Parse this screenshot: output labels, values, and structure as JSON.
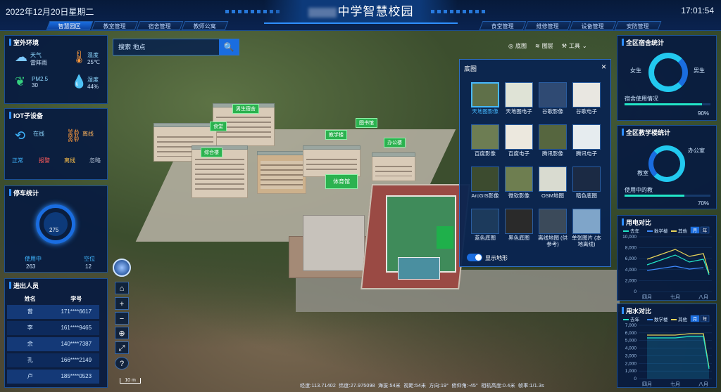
{
  "header": {
    "date": "2022年12月20日星期二",
    "title": "中学智慧校园",
    "time": "17:01:54",
    "tabs_left": [
      "智慧园区",
      "教室管理",
      "宿舍管理",
      "教师公寓"
    ],
    "tabs_right": [
      "食堂管理",
      "维修管理",
      "设备管理",
      "安防管理"
    ]
  },
  "outdoor": {
    "title": "室外环境",
    "weather_label": "天气",
    "weather_value": "雷阵雨",
    "temp_label": "温度",
    "temp_value": "25℃",
    "pm_label": "PM2.5",
    "pm_value": "30",
    "humidity_label": "湿度",
    "humidity_value": "44%"
  },
  "iot": {
    "title": "IOT子设备",
    "online": "在线",
    "offline": "离线",
    "normal": "正常",
    "alarm": "报警",
    "offline2": "离线",
    "ignore": "忽略"
  },
  "parking": {
    "title": "停车统计",
    "total": "275",
    "in_use_label": "使用中",
    "in_use": "263",
    "free_label": "空位",
    "free": "12"
  },
  "people": {
    "title": "进出人员",
    "col_name": "姓名",
    "col_id": "学号",
    "rows": [
      {
        "name": "曾",
        "id": "171****6617"
      },
      {
        "name": "李",
        "id": "161****9465"
      },
      {
        "name": "余",
        "id": "140****7387"
      },
      {
        "name": "孔",
        "id": "166****2149"
      },
      {
        "name": "卢",
        "id": "185****0523"
      }
    ]
  },
  "search": {
    "placeholder": "搜索 地点",
    "btn": "🔍"
  },
  "toolbar": {
    "basemap": "底图",
    "layers": "图层",
    "tools": "工具"
  },
  "basemap": {
    "title": "底图",
    "close": "×",
    "toggle_label": "显示地形",
    "items": [
      {
        "label": "天地图影像",
        "color": "#5f7049"
      },
      {
        "label": "天地图电子",
        "color": "#dfe3d6"
      },
      {
        "label": "谷歌影像",
        "color": "#2f4a73"
      },
      {
        "label": "谷歌电子",
        "color": "#e9e7e1"
      },
      {
        "label": "百度影像",
        "color": "#6d7d53"
      },
      {
        "label": "百度电子",
        "color": "#ece8de"
      },
      {
        "label": "腾讯影像",
        "color": "#56663f"
      },
      {
        "label": "腾讯电子",
        "color": "#e6ecef"
      },
      {
        "label": "ArcGIS影像",
        "color": "#3c4b2f"
      },
      {
        "label": "微软影像",
        "color": "#6e7e50"
      },
      {
        "label": "OSM地图",
        "color": "#d9dbd0"
      },
      {
        "label": "暗色底图",
        "color": "#1b2a44"
      },
      {
        "label": "蓝色底图",
        "color": "#1c3a5c"
      },
      {
        "label": "黑色底图",
        "color": "#2a2a2a"
      },
      {
        "label": "离线地图 (供参考)",
        "color": "#3b4a5a"
      },
      {
        "label": "单张图片 (本地离线)",
        "color": "#7fa5c9"
      }
    ]
  },
  "dorm": {
    "title": "全区宿舍统计",
    "female": "女生",
    "male": "男生",
    "usage_label": "宿舍使用情况",
    "usage": "90%",
    "usage_value": 0.9
  },
  "teach": {
    "title": "全区教学楼统计",
    "office": "办公室",
    "classroom": "教室",
    "in_use_label": "使用中的教",
    "usage": "70%",
    "usage_value": 0.7
  },
  "power": {
    "title": "用电对比",
    "legend": [
      "去年",
      "数学楼",
      "其他"
    ],
    "toggle": [
      "月",
      "年"
    ],
    "yticks": [
      "10,000",
      "8,000",
      "6,000",
      "4,000",
      "2,000",
      "0"
    ],
    "xticks": [
      "四月",
      "七月",
      "八月"
    ]
  },
  "water": {
    "title": "用水对比",
    "legend": [
      "去年",
      "数学楼",
      "其他"
    ],
    "toggle": [
      "月",
      "年"
    ],
    "yticks": [
      "7,000",
      "6,000",
      "5,000",
      "4,000",
      "3,000",
      "2,000",
      "1,000",
      "0"
    ],
    "xticks": [
      "四月",
      "七月",
      "八月"
    ]
  },
  "buildings": [
    "男生宿舍",
    "食堂",
    "教学楼",
    "体育馆",
    "综合楼",
    "办公楼",
    "图书馆"
  ],
  "status": {
    "lon": "经度:113.71402",
    "lat": "纬度:27.975098",
    "alt": "海拔:54米",
    "cam": "视距:54米",
    "heading": "方向:19°",
    "pitch": "俯仰角:-45°",
    "height": "相机高度:0.4米",
    "fps": "帧率:1/1.3s"
  },
  "scale": "10 m",
  "colors": {
    "accent": "#2f8fff",
    "cyan": "#22e6c8",
    "green": "#2bb24f"
  }
}
